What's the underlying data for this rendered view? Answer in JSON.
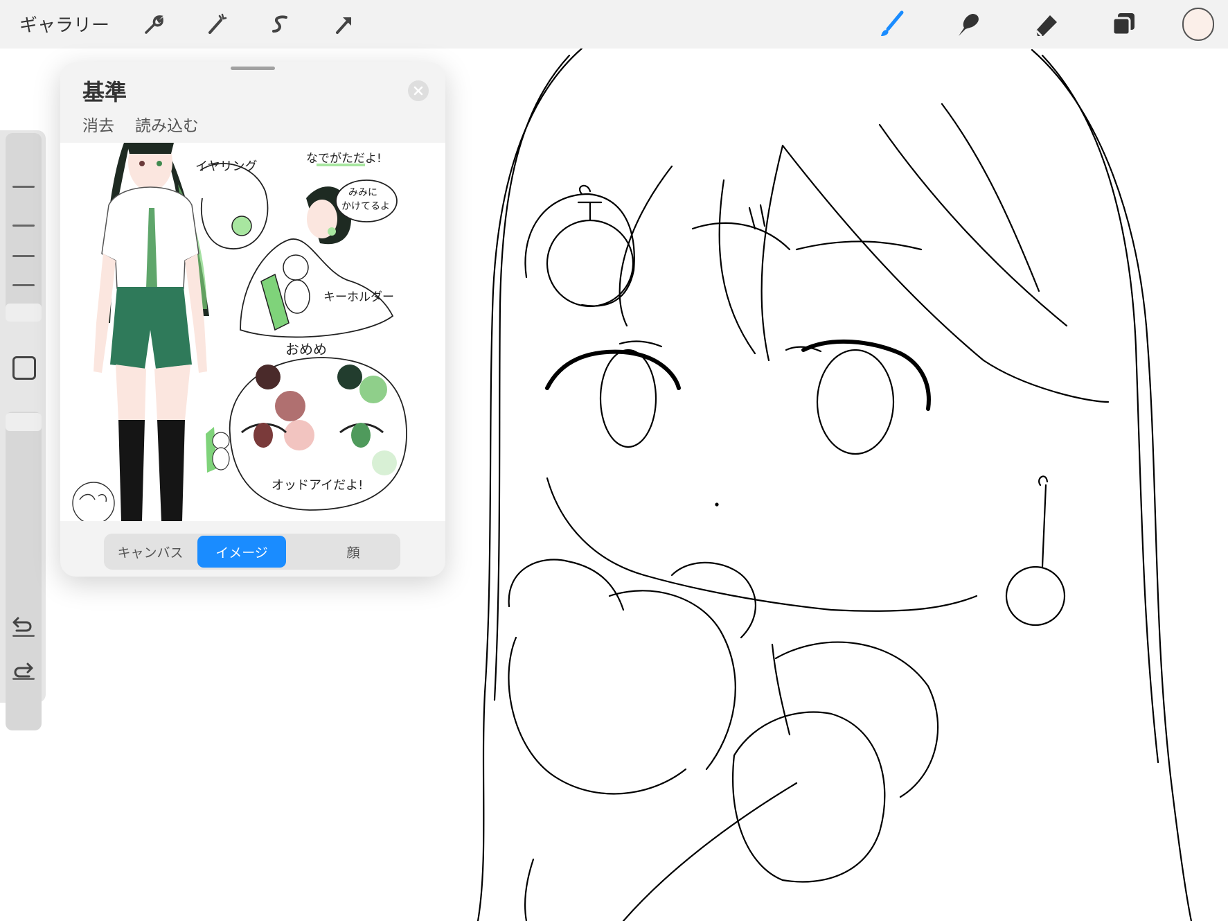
{
  "topbar": {
    "gallery_label": "ギャラリー",
    "left_tools": [
      "wrench-icon",
      "magic-wand-icon",
      "selection-s-icon",
      "transform-arrow-icon"
    ],
    "right_tools": [
      "brush-icon",
      "smudge-icon",
      "eraser-icon",
      "layers-icon"
    ],
    "accent_color": "#1a8cff",
    "current_color": "#fbefe9"
  },
  "sidebar": {
    "icons": [
      "modify-square-icon",
      "undo-icon",
      "redo-icon"
    ]
  },
  "reference": {
    "title": "基準",
    "clear_label": "消去",
    "import_label": "読み込む",
    "image": {
      "notes": {
        "earring": "イヤリング",
        "shoulders": "なでがただよ!",
        "ear_line1": "みみに",
        "ear_line2": "かけてるよ",
        "keyholder": "キーホルダー",
        "eyes": "おめめ",
        "odd_eye": "オッドアイだよ!"
      },
      "palette": [
        "#4a2a2a",
        "#b07070",
        "#f2c4c0",
        "#223d2e",
        "#8fcf8a",
        "#d8f0d5"
      ]
    },
    "tabs": [
      {
        "label": "キャンバス",
        "active": false
      },
      {
        "label": "イメージ",
        "active": true
      },
      {
        "label": "顔",
        "active": false
      }
    ]
  }
}
